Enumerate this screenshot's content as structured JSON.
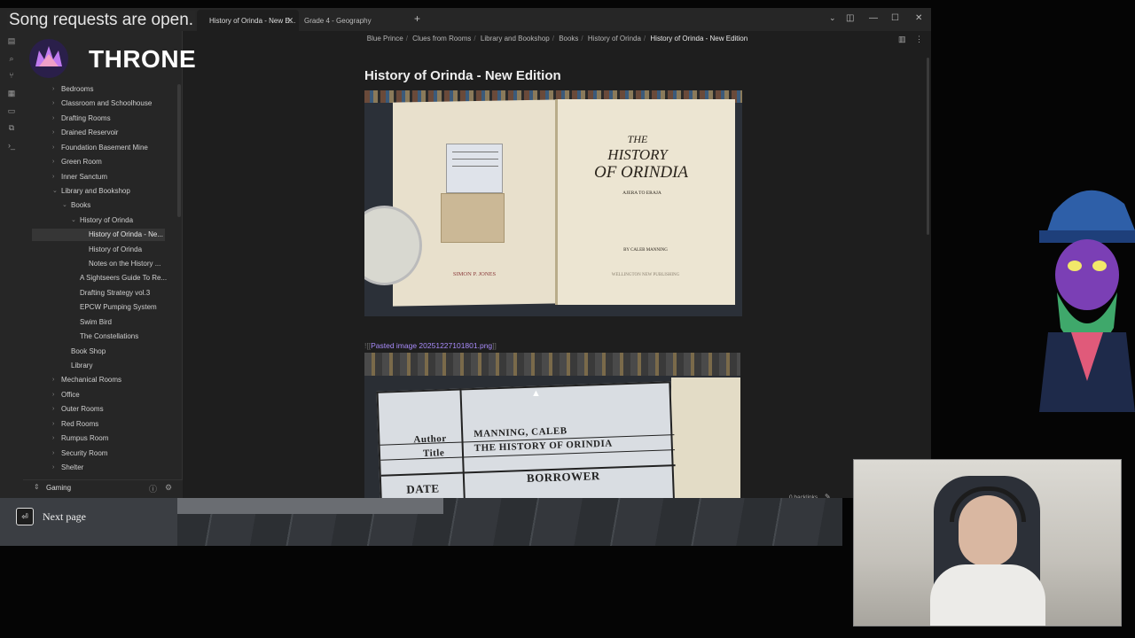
{
  "overlay": {
    "song_banner": "Song requests are open.",
    "throne_label": "THRONE",
    "next_page": "Next page"
  },
  "tabs": [
    {
      "label": "History of Orinda - New E...",
      "active": true
    },
    {
      "label": "Grade 4 - Geography",
      "active": false
    }
  ],
  "breadcrumb": [
    "Blue Prince",
    "Clues from Rooms",
    "Library and Bookshop",
    "Books",
    "History of Orinda",
    "History of Orinda - New Edition"
  ],
  "sidebar": {
    "items": [
      {
        "label": "Bedrooms",
        "depth": 0,
        "expanded": false
      },
      {
        "label": "Classroom and Schoolhouse",
        "depth": 0,
        "expanded": false
      },
      {
        "label": "Drafting Rooms",
        "depth": 0,
        "expanded": false
      },
      {
        "label": "Drained Reservoir",
        "depth": 0,
        "expanded": false
      },
      {
        "label": "Foundation Basement Mine",
        "depth": 0,
        "expanded": false
      },
      {
        "label": "Green Room",
        "depth": 0,
        "expanded": false
      },
      {
        "label": "Inner Sanctum",
        "depth": 0,
        "expanded": false
      },
      {
        "label": "Library and Bookshop",
        "depth": 0,
        "expanded": true
      },
      {
        "label": "Books",
        "depth": 1,
        "expanded": true
      },
      {
        "label": "History of Orinda",
        "depth": 2,
        "expanded": true
      },
      {
        "label": "History of Orinda - Ne...",
        "depth": 3,
        "selected": true
      },
      {
        "label": "History of Orinda",
        "depth": 3
      },
      {
        "label": "Notes on the History ...",
        "depth": 3
      },
      {
        "label": "A Sightseers Guide To Re...",
        "depth": 2
      },
      {
        "label": "Drafting Strategy vol.3",
        "depth": 2
      },
      {
        "label": "EPCW Pumping System",
        "depth": 2
      },
      {
        "label": "Swim Bird",
        "depth": 2
      },
      {
        "label": "The Constellations",
        "depth": 2
      },
      {
        "label": "Book Shop",
        "depth": 1
      },
      {
        "label": "Library",
        "depth": 1
      },
      {
        "label": "Mechanical Rooms",
        "depth": 0,
        "expanded": false
      },
      {
        "label": "Office",
        "depth": 0,
        "expanded": false
      },
      {
        "label": "Outer Rooms",
        "depth": 0,
        "expanded": false
      },
      {
        "label": "Red Rooms",
        "depth": 0,
        "expanded": false
      },
      {
        "label": "Rumpus Room",
        "depth": 0,
        "expanded": false
      },
      {
        "label": "Security Room",
        "depth": 0,
        "expanded": false
      },
      {
        "label": "Shelter",
        "depth": 0,
        "expanded": false
      }
    ],
    "vault_name": "Gaming"
  },
  "note": {
    "title": "History of Orinda - New Edition",
    "embed_link": "Pasted image 20251227101801.png",
    "backlinks": "0 backlinks"
  },
  "image1": {
    "heading_the": "THE",
    "heading_history": "HISTORY",
    "heading_of": "OF ORINDIA",
    "subtitle": "AJERA TO ERAJA",
    "author": "BY CALEB MANNING",
    "publisher": "WELLINGTON NEW PUBLISHING",
    "stamp_name": "SIMON P. JONES"
  },
  "image2": {
    "author_label": "Author",
    "title_label": "Title",
    "author_value": "MANNING, CALEB",
    "title_value": "THE HISTORY OF ORINDIA",
    "date_label": "DATE",
    "borrower_label": "BORROWER"
  },
  "colors": {
    "accent": "#a88bfa",
    "window_bg": "#1e1e1e",
    "sidebar_bg": "#262626"
  }
}
